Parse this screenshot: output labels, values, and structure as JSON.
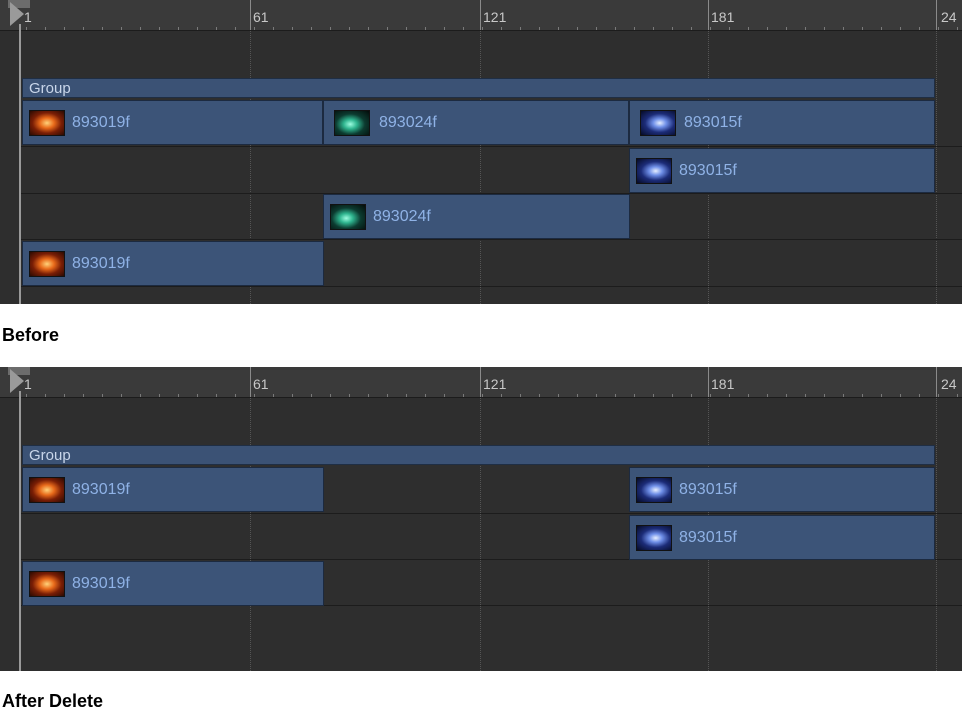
{
  "ruler": {
    "labels": [
      "1",
      "61",
      "121",
      "181",
      "24"
    ]
  },
  "before": {
    "caption": "Before",
    "group_label": "Group",
    "clips": {
      "row1_a": "893019f",
      "row1_b": "893024f",
      "row1_c": "893015f",
      "row2_a": "893015f",
      "row3_a": "893024f",
      "row4_a": "893019f"
    }
  },
  "after": {
    "caption": "After Delete",
    "group_label": "Group",
    "clips": {
      "row1_a": "893019f",
      "row1_c": "893015f",
      "row2_a": "893015f",
      "row3_a": "893019f"
    }
  },
  "thumbnails": {
    "893019f": "orange-streak",
    "893024f": "green-smoke",
    "893015f": "blue-flare"
  }
}
